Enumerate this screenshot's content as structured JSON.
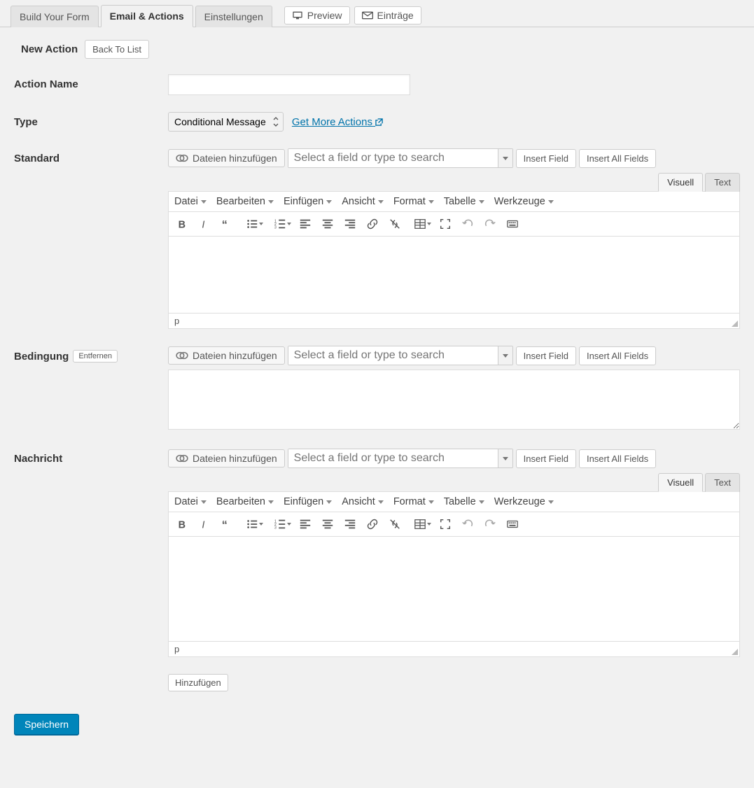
{
  "tabs": {
    "build": "Build Your Form",
    "email": "Email & Actions",
    "settings": "Einstellungen"
  },
  "tools": {
    "preview": "Preview",
    "entries": "Einträge"
  },
  "subheader": {
    "title": "New Action",
    "back": "Back To List"
  },
  "labels": {
    "actionName": "Action Name",
    "type": "Type",
    "standard": "Standard",
    "bedingung": "Bedingung",
    "nachricht": "Nachricht"
  },
  "type": {
    "selected": "Conditional Message",
    "more": "Get More Actions "
  },
  "inserter": {
    "addMedia": "Dateien hinzufügen",
    "placeholder": "Select a field or type to search",
    "insertField": "Insert Field",
    "insertAll": "Insert All Fields"
  },
  "editor": {
    "tabVisual": "Visuell",
    "tabText": "Text",
    "menu": {
      "datei": "Datei",
      "bearbeiten": "Bearbeiten",
      "einfuegen": "Einfügen",
      "ansicht": "Ansicht",
      "format": "Format",
      "tabelle": "Tabelle",
      "werkzeuge": "Werkzeuge"
    },
    "status": "p"
  },
  "buttons": {
    "entfernen": "Entfernen",
    "hinzufuegen": "Hinzufügen",
    "save": "Speichern"
  }
}
